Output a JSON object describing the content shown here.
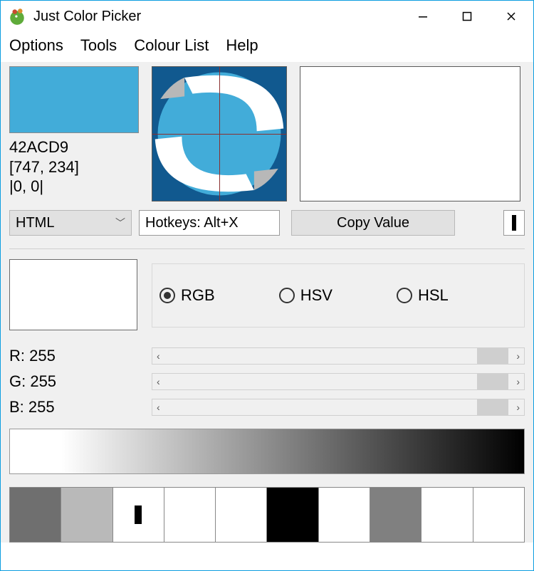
{
  "window": {
    "title": "Just Color Picker"
  },
  "menu": {
    "options": "Options",
    "tools": "Tools",
    "colour_list": "Colour List",
    "help": "Help"
  },
  "picked": {
    "color_hex": "42ACD9",
    "hex_display": "42ACD9",
    "coords": "[747, 234]",
    "offset": "|0, 0|"
  },
  "format": {
    "selected": "HTML"
  },
  "hotkeys": {
    "text": "Hotkeys: Alt+X"
  },
  "buttons": {
    "copy": "Copy Value"
  },
  "model": {
    "rgb": "RGB",
    "hsv": "HSV",
    "hsl": "HSL",
    "selected": "rgb"
  },
  "channels": {
    "r_label": "R: 255",
    "g_label": "G: 255",
    "b_label": "B: 255",
    "r": 255,
    "g": 255,
    "b": 255
  },
  "track_arrows": {
    "left": "‹",
    "right": "›"
  },
  "palette": [
    "#6f6f6f",
    "#b9b9b9",
    "#ffffff",
    "#ffffff",
    "#ffffff",
    "#000000",
    "#ffffff",
    "#808080",
    "#ffffff",
    "#ffffff"
  ],
  "palette_marker_index": 2,
  "edit_swatch_color": "#ffffff"
}
